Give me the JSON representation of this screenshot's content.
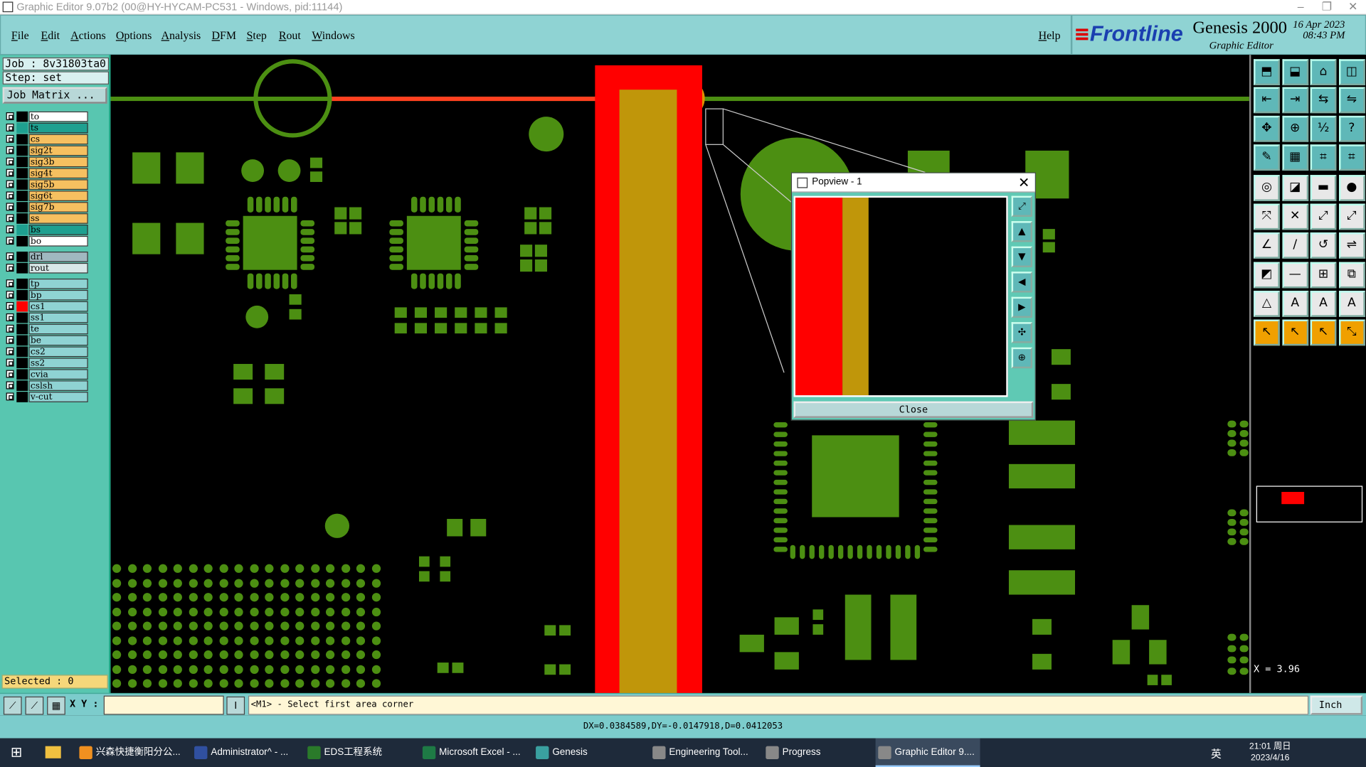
{
  "window": {
    "title": "Graphic Editor 9.07b2 (00@HY-HYCAM-PC531 - Windows, pid:11144)"
  },
  "menu": [
    "File",
    "Edit",
    "Actions",
    "Options",
    "Analysis",
    "DFM",
    "Step",
    "Rout",
    "Windows"
  ],
  "help": "Help",
  "brand": {
    "logo": "Frontline",
    "product": "Genesis 2000",
    "subtitle": "Graphic Editor",
    "date": "16 Apr 2023",
    "time": "08:43 PM"
  },
  "job": {
    "job_label": "Job  : 8v31803ta0",
    "step_label": "Step: set",
    "matrix_button": "Job Matrix ..."
  },
  "layers": [
    {
      "name": "to",
      "color": "#ffffff",
      "swatch": "#000000"
    },
    {
      "name": "ts",
      "color": "#1fa090",
      "swatch": "#1fa090"
    },
    {
      "name": "cs",
      "color": "#f6c060",
      "swatch": "#000000"
    },
    {
      "name": "sig2t",
      "color": "#f6c060",
      "swatch": "#000000"
    },
    {
      "name": "sig3b",
      "color": "#f6c060",
      "swatch": "#000000"
    },
    {
      "name": "sig4t",
      "color": "#f6c060",
      "swatch": "#000000"
    },
    {
      "name": "sig5b",
      "color": "#f6c060",
      "swatch": "#000000"
    },
    {
      "name": "sig6t",
      "color": "#f6c060",
      "swatch": "#000000"
    },
    {
      "name": "sig7b",
      "color": "#f6c060",
      "swatch": "#000000"
    },
    {
      "name": "ss",
      "color": "#f6c060",
      "swatch": "#000000"
    },
    {
      "name": "bs",
      "color": "#1fa090",
      "swatch": "#1fa090"
    },
    {
      "name": "bo",
      "color": "#ffffff",
      "swatch": "#000000"
    },
    {
      "name": "drl",
      "color": "#a0b8c0",
      "swatch": "#000000"
    },
    {
      "name": "rout",
      "color": "#d8e8e8",
      "swatch": "#000000"
    },
    {
      "name": "tp",
      "color": "#8fd3d3",
      "swatch": "#000000"
    },
    {
      "name": "bp",
      "color": "#8fd3d3",
      "swatch": "#000000"
    },
    {
      "name": "cs1",
      "color": "#8fd3d3",
      "swatch": "#ff0000"
    },
    {
      "name": "ss1",
      "color": "#8fd3d3",
      "swatch": "#000000"
    },
    {
      "name": "te",
      "color": "#8fd3d3",
      "swatch": "#000000"
    },
    {
      "name": "be",
      "color": "#8fd3d3",
      "swatch": "#000000"
    },
    {
      "name": "cs2",
      "color": "#8fd3d3",
      "swatch": "#000000"
    },
    {
      "name": "ss2",
      "color": "#8fd3d3",
      "swatch": "#000000"
    },
    {
      "name": "cvia",
      "color": "#8fd3d3",
      "swatch": "#000000"
    },
    {
      "name": "cslsh",
      "color": "#8fd3d3",
      "swatch": "#000000"
    },
    {
      "name": "v-cut",
      "color": "#8fd3d3",
      "swatch": "#000000"
    }
  ],
  "selected": "Selected : 0",
  "popview": {
    "title": "Popview - 1",
    "close": "Close"
  },
  "right": {
    "x_readout": "X = 3.96"
  },
  "cmd": {
    "xy_label": "X Y :",
    "prompt": "<M1> - Select first area corner",
    "units": "Inch"
  },
  "status": {
    "measure": "DX=0.0384589,DY=-0.0147918,D=0.0412053"
  },
  "taskbar": {
    "items": [
      "兴森快捷衡阳分公...",
      "Administrator^ - ...",
      "EDS工程系统",
      "Microsoft Excel - ...",
      "Genesis",
      "Engineering Tool...",
      "Progress",
      "Graphic Editor 9...."
    ],
    "clock_time": "21:01 周日",
    "clock_date": "2023/4/16",
    "ime": "英"
  },
  "colors": {
    "copper": "#4c8f12",
    "highlight": "#ff0000",
    "gold": "#c0960a",
    "panel": "#8fd3d3"
  }
}
